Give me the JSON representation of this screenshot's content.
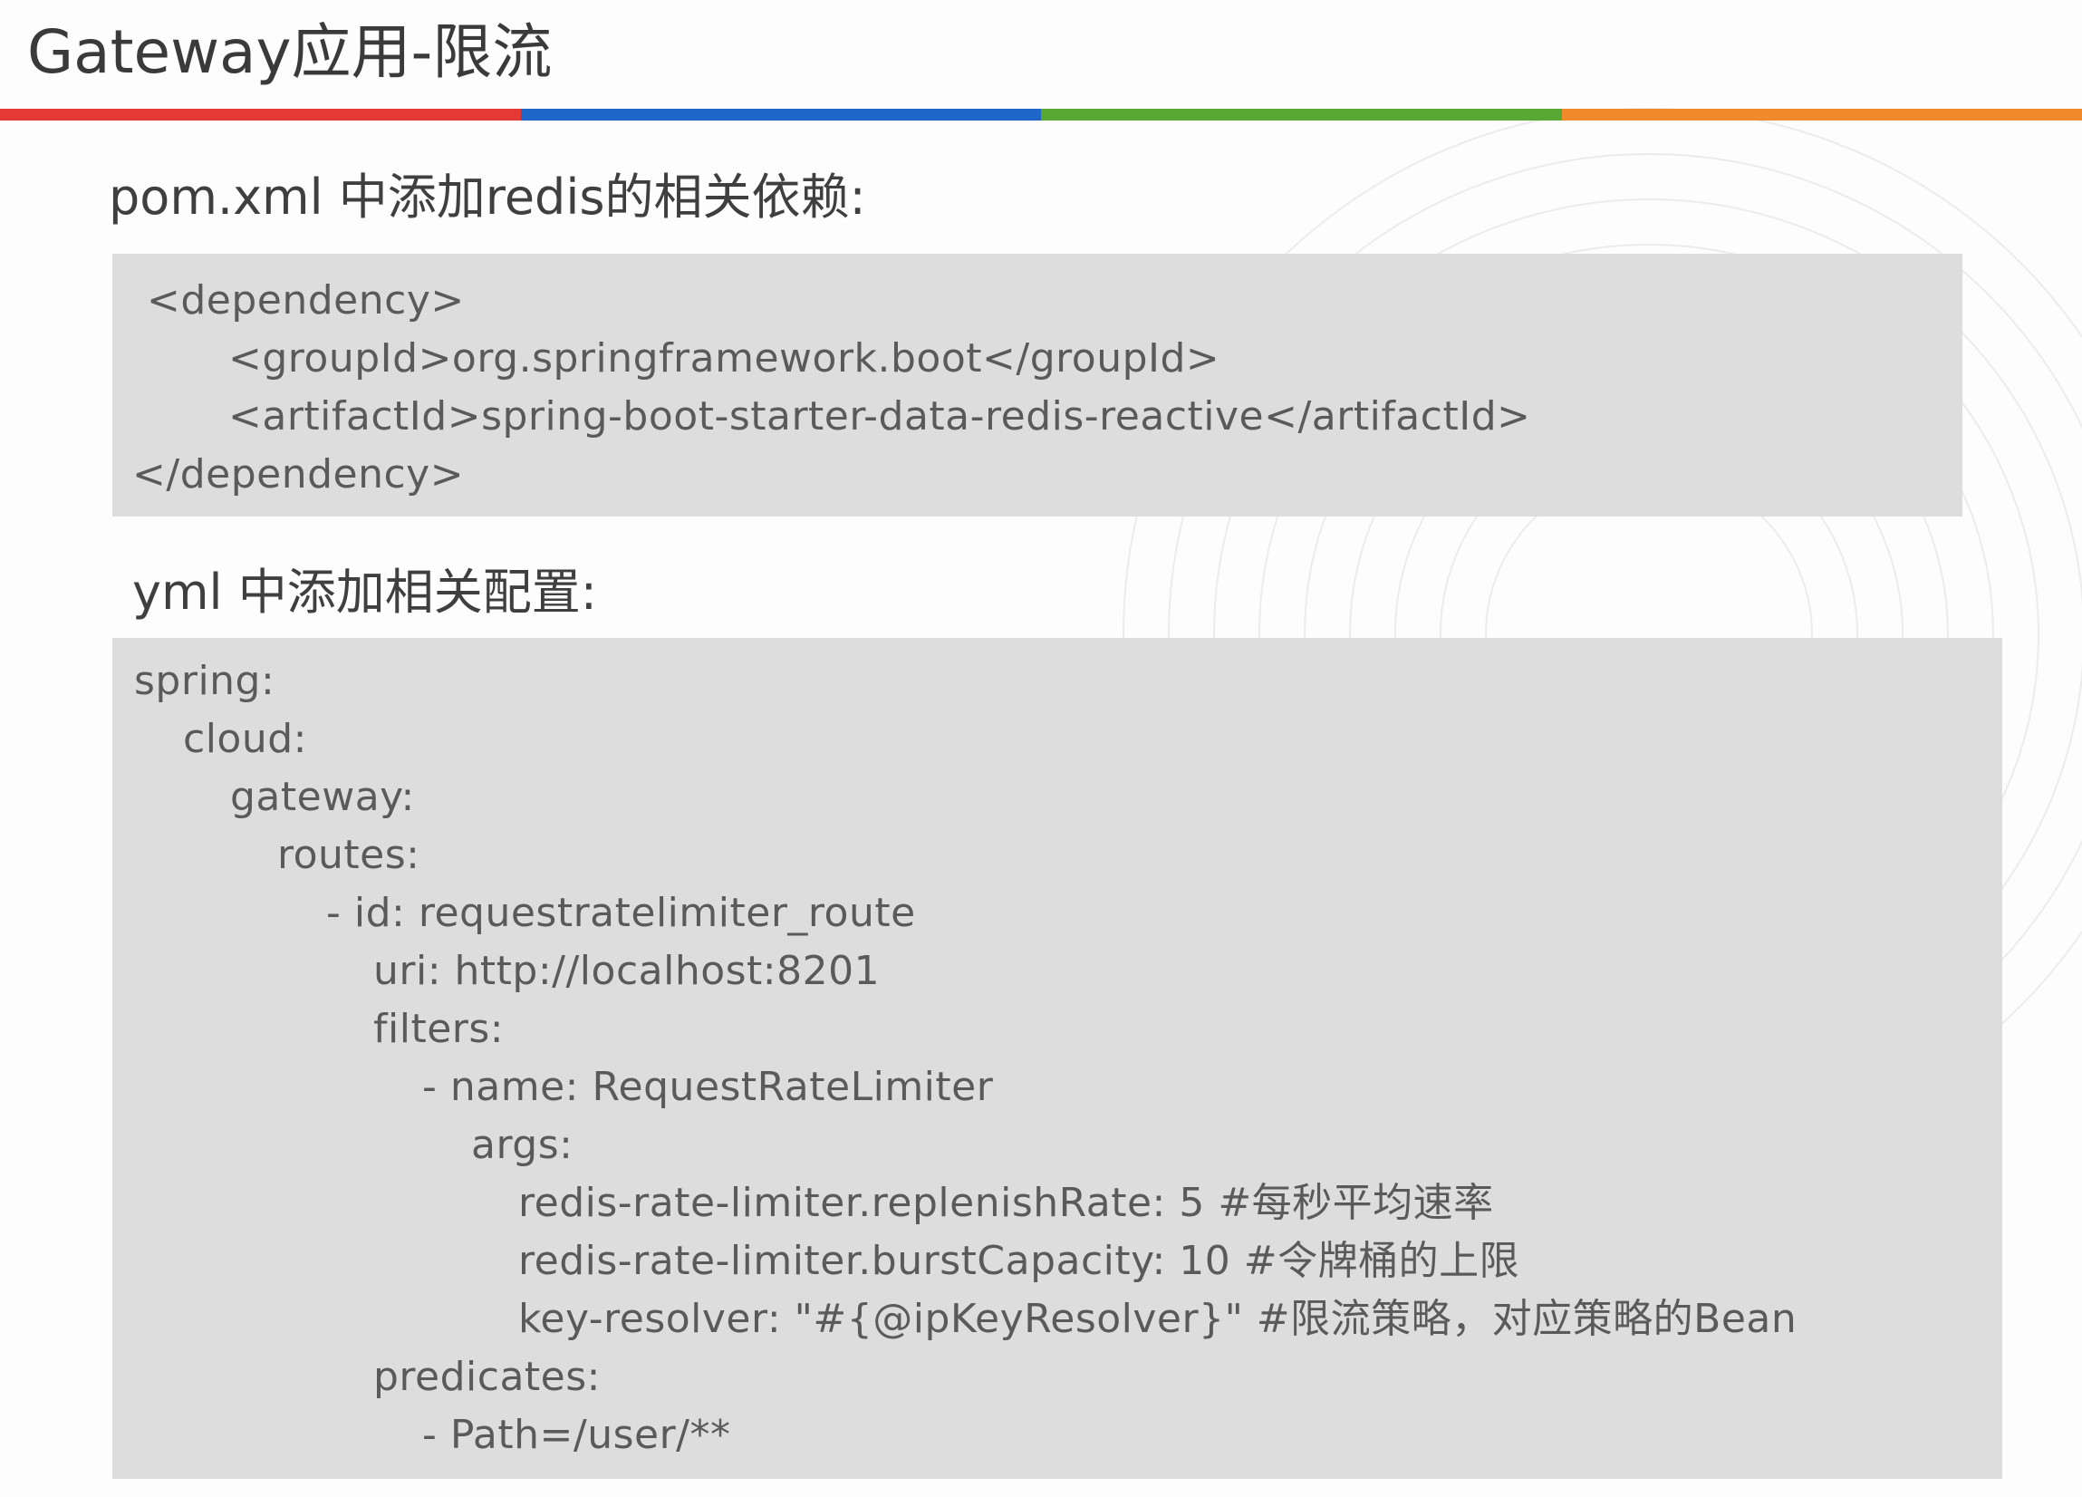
{
  "title": "Gateway应用-限流",
  "accent_colors": [
    "#e53935",
    "#1e66c8",
    "#5aa834",
    "#f08a2c"
  ],
  "pom_section": {
    "heading": "pom.xml 中添加redis的相关依赖:",
    "lines": [
      "<dependency>",
      "<groupId>org.springframework.boot</groupId>",
      "<artifactId>spring-boot-starter-data-redis-reactive</artifactId>",
      "</dependency>"
    ]
  },
  "yml_section": {
    "heading": "yml 中添加相关配置:",
    "lines": [
      "spring:",
      "cloud:",
      "gateway:",
      "routes:",
      "- id: requestratelimiter_route",
      "uri: http://localhost:8201",
      "filters:",
      "- name: RequestRateLimiter",
      "args:",
      "redis-rate-limiter.replenishRate: 5 #每秒平均速率",
      "redis-rate-limiter.burstCapacity: 10 #令牌桶的上限",
      "key-resolver: \"#{@ipKeyResolver}\" #限流策略，对应策略的Bean",
      "predicates:",
      "- Path=/user/**"
    ]
  }
}
